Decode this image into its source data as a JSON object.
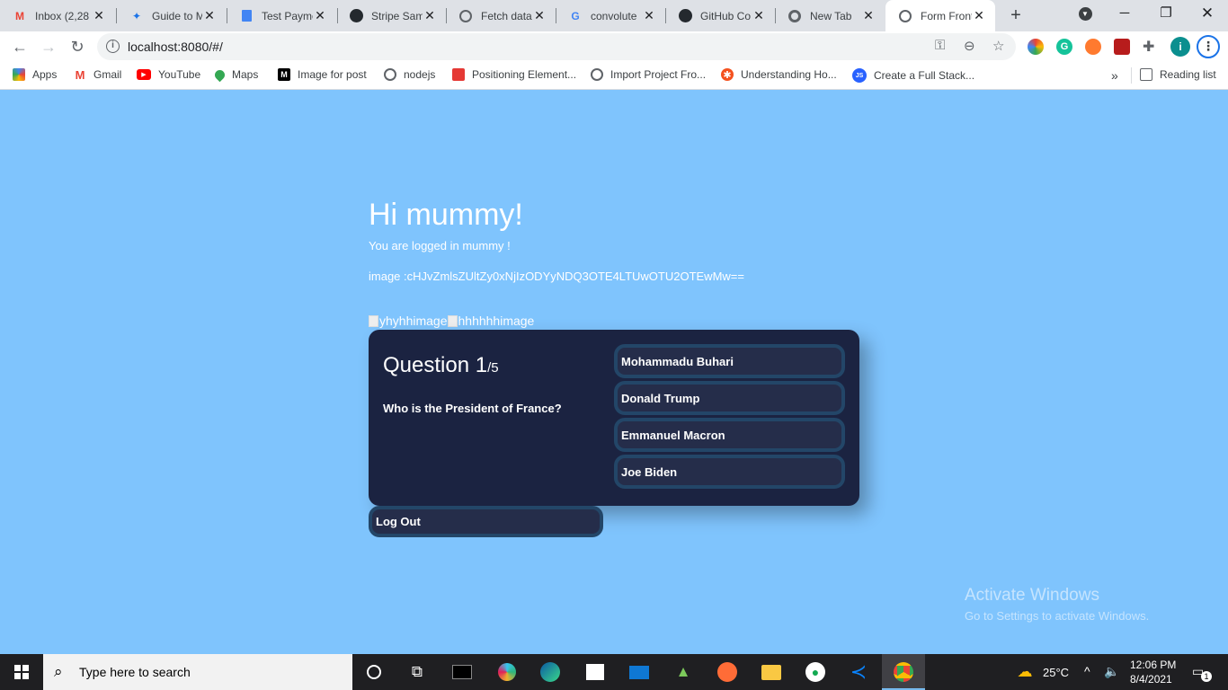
{
  "browser": {
    "tabs": [
      {
        "label": "Inbox (2,28",
        "icon": "gmail-icon",
        "color": "#ea4335"
      },
      {
        "label": "Guide to M",
        "icon": "guide-icon",
        "color": "#1a73e8"
      },
      {
        "label": "Test Payme",
        "icon": "docs-icon",
        "color": "#4285f4"
      },
      {
        "label": "Stripe Sam",
        "icon": "github-icon",
        "color": "#24292e"
      },
      {
        "label": "Fetch data",
        "icon": "globe-icon",
        "color": "#5f6368"
      },
      {
        "label": "convolute",
        "icon": "google-icon",
        "color": "#4285f4"
      },
      {
        "label": "GitHub Co",
        "icon": "github-icon",
        "color": "#24292e"
      },
      {
        "label": "New Tab",
        "icon": "chrome-icon",
        "color": "#5f6368"
      },
      {
        "label": "Form Front",
        "icon": "globe-icon",
        "color": "#5f6368",
        "active": true
      }
    ],
    "url": "localhost:8080/#/",
    "bookmarks": [
      {
        "label": "Apps",
        "icon": "apps-icon",
        "color": "#4285f4"
      },
      {
        "label": "Gmail",
        "icon": "gmail-icon",
        "color": "#ea4335"
      },
      {
        "label": "YouTube",
        "icon": "youtube-icon",
        "color": "#ff0000"
      },
      {
        "label": "Maps",
        "icon": "maps-icon",
        "color": "#34a853"
      },
      {
        "label": "Image for post",
        "icon": "medium-icon",
        "color": "#000000"
      },
      {
        "label": "nodejs",
        "icon": "globe-icon",
        "color": "#5f6368"
      },
      {
        "label": "Positioning Element...",
        "icon": "bookmark-icon",
        "color": "#e53935"
      },
      {
        "label": "Import Project Fro...",
        "icon": "globe-icon",
        "color": "#5f6368"
      },
      {
        "label": "Understanding Ho...",
        "icon": "flower-icon",
        "color": "#f4511e"
      },
      {
        "label": "Create a Full Stack...",
        "icon": "js-icon",
        "color": "#2962ff"
      }
    ],
    "more_bookmarks": "»",
    "reading_list": "Reading list",
    "profile_initial": "i"
  },
  "page": {
    "greeting": "Hi mummy!",
    "logged_in_text": "You are logged in mummy !",
    "image_text": "image :cHJvZmlsZUltZy0xNjIzODYyNDQ3OTE4LTUwOTU2OTEwMw==",
    "image_alts": [
      "yhyhhimage",
      "hhhhhhimage"
    ],
    "quiz": {
      "question_label": "Question 1",
      "question_total": "/5",
      "question_text": "Who is the President of France?",
      "answers": [
        "Mohammadu Buhari",
        "Donald Trump",
        "Emmanuel Macron",
        "Joe Biden"
      ]
    },
    "logout_label": "Log Out",
    "watermark": {
      "line1": "Activate Windows",
      "line2": "Go to Settings to activate Windows."
    }
  },
  "taskbar": {
    "search_placeholder": "Type here to search",
    "weather": "25°C",
    "time": "12:06 PM",
    "date": "8/4/2021",
    "notification_count": "1"
  }
}
